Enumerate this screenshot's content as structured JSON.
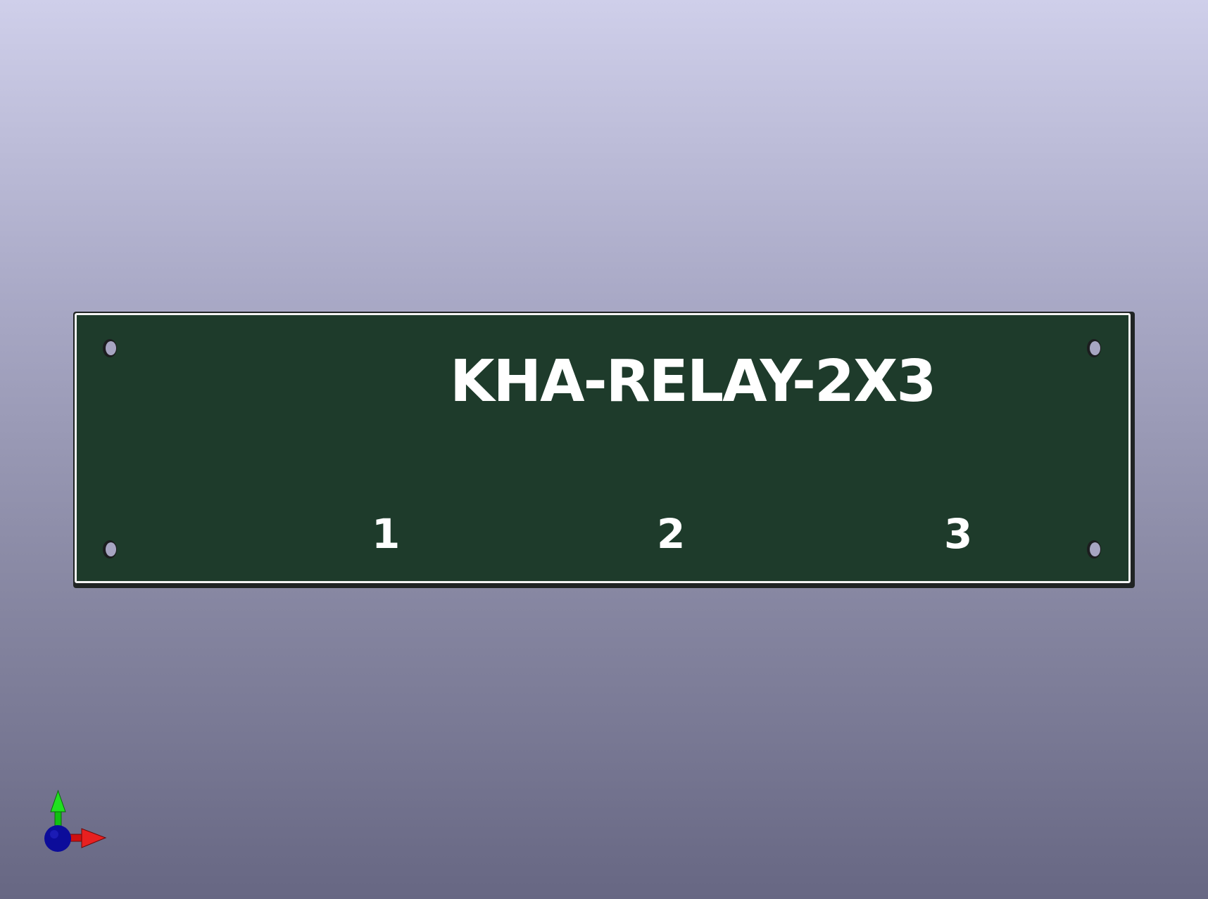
{
  "board": {
    "title": "KHA-RELAY-2X3",
    "pin_labels": [
      "1",
      "2",
      "3"
    ],
    "colors": {
      "solder_mask": "#1e3b2b",
      "silkscreen": "#ffffff",
      "edge": "#f4f4f4"
    }
  },
  "axis_indicator": {
    "axes": [
      "y-axis-arrow",
      "x-axis-arrow",
      "z-axis-origin"
    ],
    "colors": {
      "x": "#e01010",
      "y": "#10d010",
      "z": "#1010a0"
    }
  },
  "background": {
    "gradient_top": "#cfcfea",
    "gradient_bottom": "#676783"
  }
}
